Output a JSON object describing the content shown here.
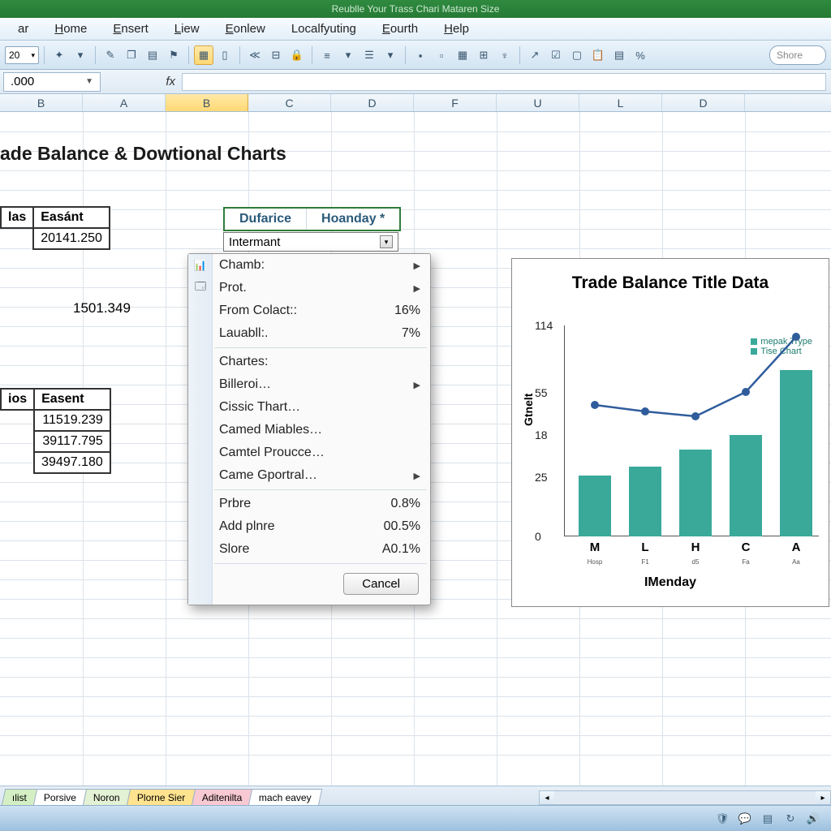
{
  "window_title": "Reublle Your Trass Chari Mataren Size",
  "menus": [
    "ar",
    "Home",
    "Ensert",
    "Liew",
    "Eonlew",
    "Localfyuting",
    "Eourth",
    "Help"
  ],
  "toolbar_combo": "20",
  "search_placeholder": "Shore",
  "namebox": ".000",
  "fx_label": "fx",
  "columns": [
    "B",
    "A",
    "B",
    "C",
    "D",
    "F",
    "U",
    "L",
    "D"
  ],
  "selected_col_index": 2,
  "page_title": "ade Balance & Dowtional Charts",
  "table1": {
    "headers": [
      "las",
      "Easánt"
    ],
    "rows": [
      [
        "",
        "20141.250"
      ]
    ]
  },
  "loose_value": "1501.349",
  "table2": {
    "headers": [
      "ios",
      "Easent"
    ],
    "rows": [
      [
        "",
        "11519.239"
      ],
      [
        "",
        "39117.795"
      ],
      [
        "",
        "39497.180"
      ]
    ]
  },
  "dd_header": [
    "Dufarice",
    "Hoanday *"
  ],
  "active_cell_value": "Intermant",
  "context_menu": {
    "items": [
      {
        "icon": "📊",
        "label": "Chamb:",
        "arrow": true
      },
      {
        "icon": "🗔",
        "label": "Prot.",
        "arrow": true
      },
      {
        "label": "From Colact::",
        "value": "16%"
      },
      {
        "label": "Lauabll:.",
        "value": "7%"
      },
      {
        "sep": true
      },
      {
        "label": "Chartes:"
      },
      {
        "label": "Billeroi…",
        "arrow": true
      },
      {
        "label": "Cissic Thart…"
      },
      {
        "label": "Camed Miables…"
      },
      {
        "label": "Camtel Proucce…"
      },
      {
        "label": "Came Gportral…",
        "arrow": true
      },
      {
        "sep": true
      },
      {
        "label": "Prbre",
        "value": "0.8%"
      },
      {
        "label": "Add plnre",
        "value": "00.5%"
      },
      {
        "label": "Slore",
        "value": "A0.1%"
      }
    ],
    "cancel": "Cancel"
  },
  "chart": {
    "title": "Trade Balance Title Data",
    "ylabel": "Gtnelt",
    "xlabel": "IMenday",
    "legend": [
      "mepak Trype",
      "Tise Chart"
    ],
    "yticks": [
      "114",
      "55",
      "18",
      "25",
      "0"
    ]
  },
  "chart_data": {
    "type": "bar",
    "categories": [
      "M",
      "L",
      "H",
      "C",
      "A"
    ],
    "sub_categories": [
      "Hosp",
      "F1",
      "d5",
      "Fa",
      "Aa"
    ],
    "series": [
      {
        "name": "Tise Chart",
        "type": "bar",
        "values": [
          33,
          38,
          47,
          55,
          90
        ]
      },
      {
        "name": "mepak Trype",
        "type": "line",
        "values": [
          72,
          68,
          64,
          78,
          108
        ]
      }
    ],
    "title": "Trade Balance Title Data",
    "xlabel": "IMenday",
    "ylabel": "Gtnelt",
    "ylim": [
      0,
      114
    ]
  },
  "sheet_tabs": [
    "ılist",
    "Porsive",
    "Noron",
    "Plorne Sier",
    "Aditenilta",
    "mach eavey"
  ]
}
